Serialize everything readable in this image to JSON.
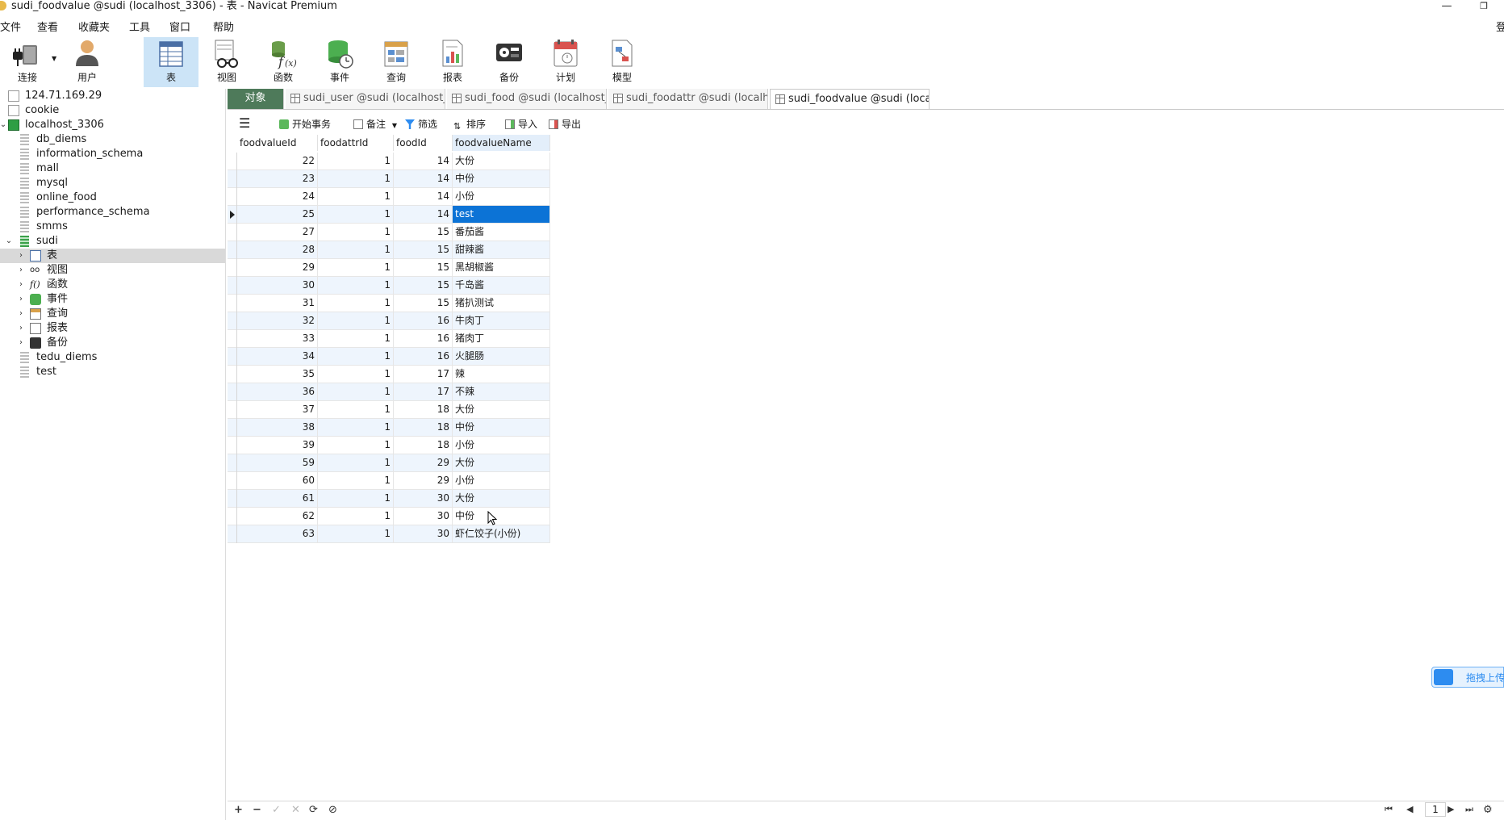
{
  "window": {
    "title": "sudi_foodvalue @sudi (localhost_3306) - 表 - Navicat Premium",
    "minimize_glyph": "—",
    "restore_glyph": "❐"
  },
  "menu": {
    "items": [
      "文件",
      "查看",
      "收藏夹",
      "工具",
      "窗口",
      "帮助"
    ],
    "right_label": "登"
  },
  "toolbar": {
    "items": [
      {
        "label": "连接",
        "icon": "plug-icon"
      },
      {
        "label": "用户",
        "icon": "user-icon"
      },
      {
        "label": "表",
        "icon": "table-icon",
        "active": true
      },
      {
        "label": "视图",
        "icon": "view-glasses-icon"
      },
      {
        "label": "函数",
        "icon": "function-icon"
      },
      {
        "label": "事件",
        "icon": "event-clock-icon"
      },
      {
        "label": "查询",
        "icon": "query-icon"
      },
      {
        "label": "报表",
        "icon": "report-icon"
      },
      {
        "label": "备份",
        "icon": "backup-icon"
      },
      {
        "label": "计划",
        "icon": "schedule-calendar-icon"
      },
      {
        "label": "模型",
        "icon": "model-icon"
      }
    ]
  },
  "sidebar": {
    "items": [
      {
        "label": "124.71.169.29",
        "type": "connection"
      },
      {
        "label": "cookie",
        "type": "connection"
      },
      {
        "label": "localhost_3306",
        "type": "connection-open"
      },
      {
        "label": "db_diems",
        "type": "database"
      },
      {
        "label": "information_schema",
        "type": "database"
      },
      {
        "label": "mall",
        "type": "database"
      },
      {
        "label": "mysql",
        "type": "database"
      },
      {
        "label": "online_food",
        "type": "database"
      },
      {
        "label": "performance_schema",
        "type": "database"
      },
      {
        "label": "smms",
        "type": "database"
      },
      {
        "label": "sudi",
        "type": "database-open"
      },
      {
        "label": "表",
        "type": "tables",
        "selected": true
      },
      {
        "label": "视图",
        "type": "views"
      },
      {
        "label": "函数",
        "type": "functions"
      },
      {
        "label": "事件",
        "type": "events"
      },
      {
        "label": "查询",
        "type": "queries"
      },
      {
        "label": "报表",
        "type": "reports"
      },
      {
        "label": "备份",
        "type": "backups"
      },
      {
        "label": "tedu_diems",
        "type": "database"
      },
      {
        "label": "test",
        "type": "database"
      }
    ]
  },
  "tabs": {
    "objects_label": "对象",
    "items": [
      {
        "label": "sudi_user @sudi (localhost_..."
      },
      {
        "label": "sudi_food @sudi (localhost_..."
      },
      {
        "label": "sudi_foodattr @sudi (localh..."
      },
      {
        "label": "sudi_foodvalue @sudi (local...",
        "active": true
      }
    ]
  },
  "subtoolbar": {
    "menu_icon": "hamburger-menu-icon",
    "begin_transaction": "开始事务",
    "memo": "备注",
    "filter": "筛选",
    "sort": "排序",
    "import": "导入",
    "export": "导出"
  },
  "grid": {
    "columns": [
      "foodvalueId",
      "foodattrId",
      "foodId",
      "foodvalueName"
    ],
    "current_row_index": 3,
    "rows": [
      [
        "22",
        "1",
        "14",
        "大份"
      ],
      [
        "23",
        "1",
        "14",
        "中份"
      ],
      [
        "24",
        "1",
        "14",
        "小份"
      ],
      [
        "25",
        "1",
        "14",
        "test"
      ],
      [
        "27",
        "1",
        "15",
        "番茄酱"
      ],
      [
        "28",
        "1",
        "15",
        "甜辣酱"
      ],
      [
        "29",
        "1",
        "15",
        "黑胡椒酱"
      ],
      [
        "30",
        "1",
        "15",
        "千岛酱"
      ],
      [
        "31",
        "1",
        "15",
        "猪扒测试"
      ],
      [
        "32",
        "1",
        "16",
        "牛肉丁"
      ],
      [
        "33",
        "1",
        "16",
        "猪肉丁"
      ],
      [
        "34",
        "1",
        "16",
        "火腿肠"
      ],
      [
        "35",
        "1",
        "17",
        "辣"
      ],
      [
        "36",
        "1",
        "17",
        "不辣"
      ],
      [
        "37",
        "1",
        "18",
        "大份"
      ],
      [
        "38",
        "1",
        "18",
        "中份"
      ],
      [
        "39",
        "1",
        "18",
        "小份"
      ],
      [
        "59",
        "1",
        "29",
        "大份"
      ],
      [
        "60",
        "1",
        "29",
        "小份"
      ],
      [
        "61",
        "1",
        "30",
        "大份"
      ],
      [
        "62",
        "1",
        "30",
        "中份"
      ],
      [
        "63",
        "1",
        "30",
        "虾仁饺子(小份)"
      ]
    ]
  },
  "upload_widget": {
    "label": "拖拽上传"
  },
  "bottombar": {
    "add": "+",
    "delete": "−",
    "apply": "✓",
    "discard": "✕",
    "refresh": "⟳",
    "stop": "⊘",
    "first": "⏮",
    "prev": "◀",
    "page": "1",
    "next": "▶",
    "last": "⏭",
    "settings": "⚙"
  }
}
